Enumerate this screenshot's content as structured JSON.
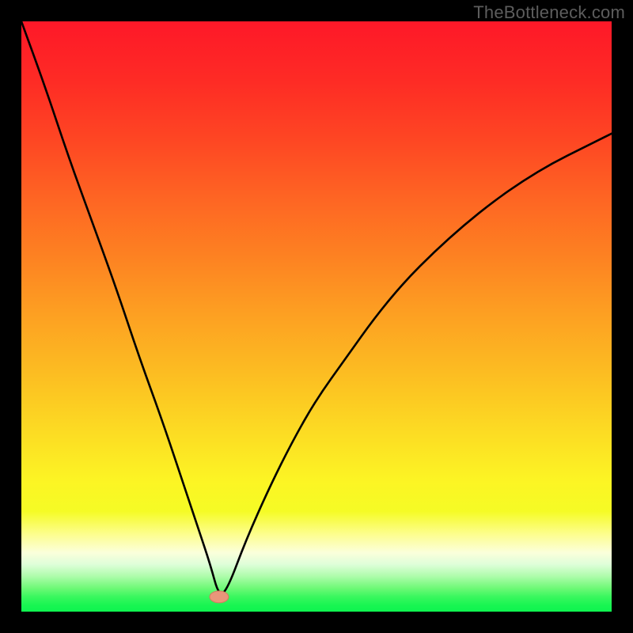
{
  "watermark": "TheBottleneck.com",
  "colors": {
    "background": "#000000",
    "gradient_stops": [
      {
        "offset": 0.0,
        "color": "#fe1828"
      },
      {
        "offset": 0.1,
        "color": "#fe2b25"
      },
      {
        "offset": 0.2,
        "color": "#fe4623"
      },
      {
        "offset": 0.3,
        "color": "#fe6523"
      },
      {
        "offset": 0.4,
        "color": "#fd8222"
      },
      {
        "offset": 0.5,
        "color": "#fda122"
      },
      {
        "offset": 0.6,
        "color": "#fcbe22"
      },
      {
        "offset": 0.7,
        "color": "#fcdd23"
      },
      {
        "offset": 0.78,
        "color": "#fcf524"
      },
      {
        "offset": 0.83,
        "color": "#f5fb25"
      },
      {
        "offset": 0.87,
        "color": "#fdfe91"
      },
      {
        "offset": 0.9,
        "color": "#fbffdb"
      },
      {
        "offset": 0.92,
        "color": "#defed9"
      },
      {
        "offset": 0.94,
        "color": "#aefcab"
      },
      {
        "offset": 0.96,
        "color": "#6ff977"
      },
      {
        "offset": 0.975,
        "color": "#39f75e"
      },
      {
        "offset": 0.99,
        "color": "#17f551"
      },
      {
        "offset": 1.0,
        "color": "#0ff450"
      }
    ],
    "curve": "#000000",
    "marker_fill": "#e9967a",
    "marker_stroke": "#d08060"
  },
  "chart_data": {
    "type": "line",
    "title": "",
    "xlabel": "",
    "ylabel": "",
    "xlim": [
      0,
      100
    ],
    "ylim": [
      0,
      100
    ],
    "grid": false,
    "series": [
      {
        "name": "bottleneck-curve",
        "x": [
          0,
          4,
          8,
          12,
          16,
          20,
          24,
          28,
          30,
          32,
          33.5,
          35,
          38,
          42,
          46,
          50,
          55,
          60,
          65,
          70,
          75,
          80,
          85,
          90,
          95,
          100
        ],
        "y": [
          100,
          89,
          77,
          66,
          55,
          43,
          32,
          20,
          14,
          8,
          2.5,
          4,
          12,
          21,
          29,
          36,
          43,
          50,
          56,
          61,
          65.5,
          69.5,
          73,
          76,
          78.5,
          81
        ]
      }
    ],
    "marker": {
      "x": 33.5,
      "y": 2.5,
      "rx": 1.6,
      "ry": 1.0
    }
  }
}
